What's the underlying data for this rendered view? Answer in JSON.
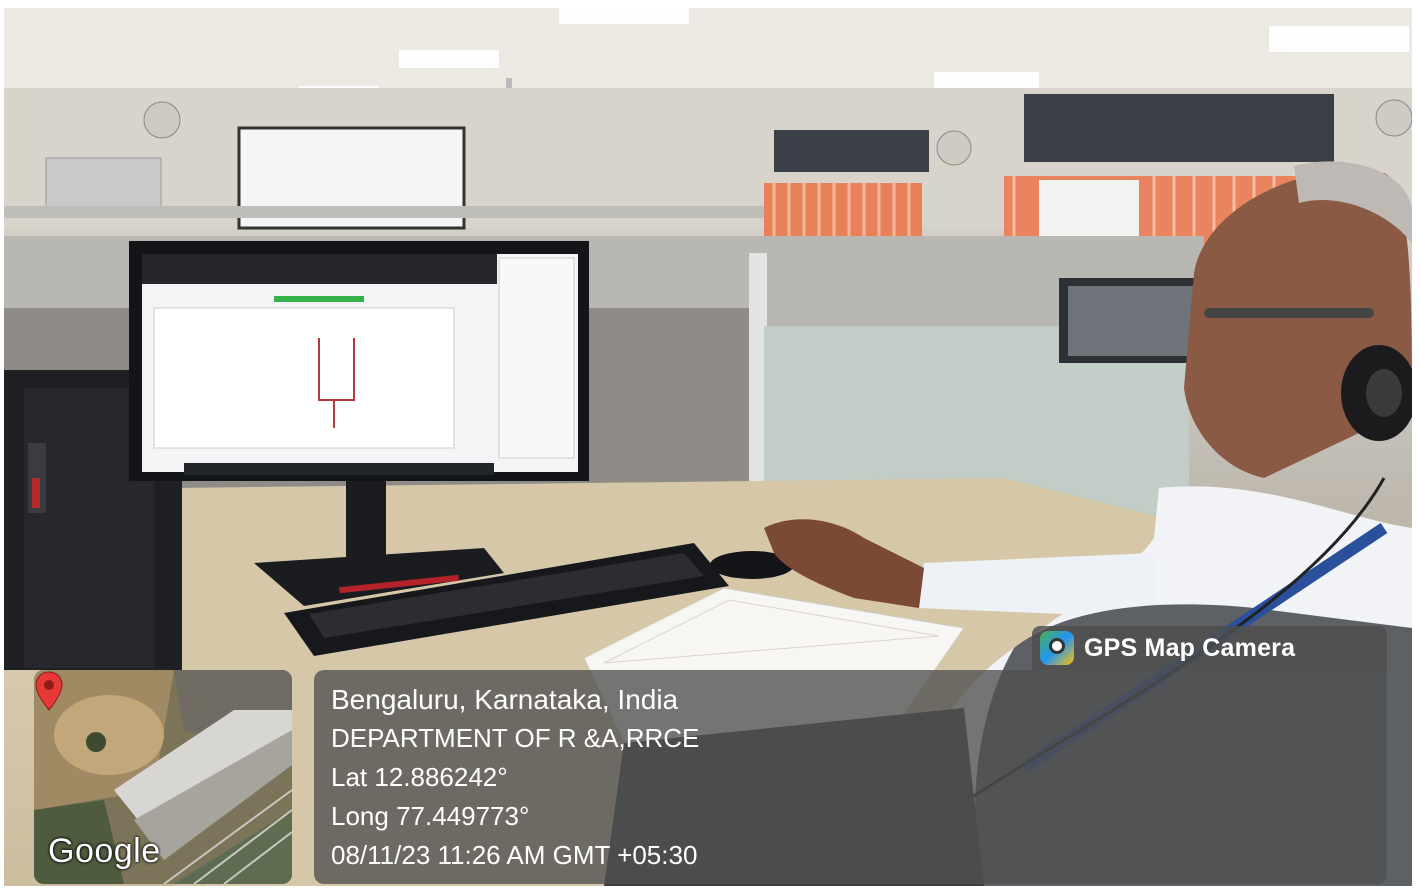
{
  "overlay": {
    "app_name": "GPS Map Camera",
    "app_icon": "gps-map-camera-app-icon",
    "location_line": "Bengaluru, Karnataka, India",
    "place_line": "DEPARTMENT OF R &A,RRCE",
    "latitude_line": "Lat 12.886242°",
    "longitude_line": "Long 77.449773°",
    "datetime_line": "08/11/23 11:26 AM GMT +05:30"
  },
  "minimap": {
    "attribution": "Google",
    "pin_icon": "map-pin-icon",
    "pin_color": "#e53935"
  },
  "colors": {
    "overlay_bg": "#505050",
    "overlay_text": "#ffffff",
    "curtains": "#e8815a"
  }
}
